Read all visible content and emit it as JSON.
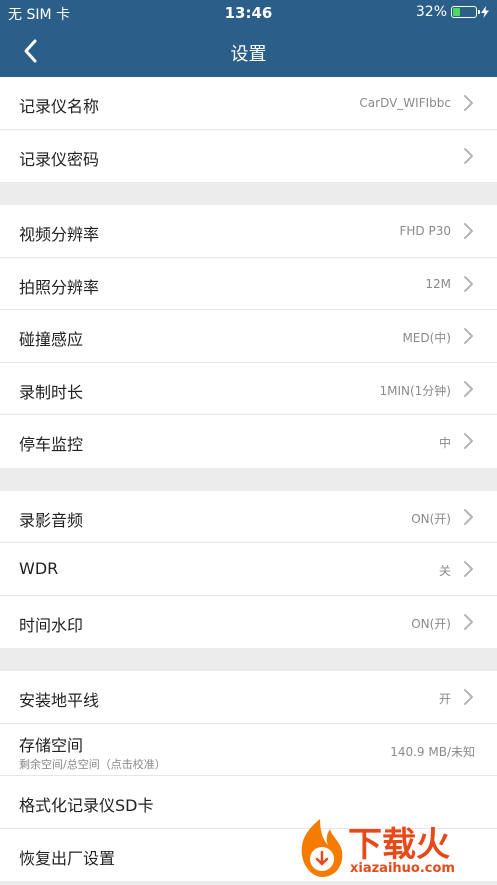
{
  "status": {
    "carrier": "无 SIM 卡",
    "time": "13:46",
    "battery": "32%",
    "battery_level": 0.32
  },
  "nav": {
    "title": "设置"
  },
  "groups": [
    [
      {
        "label": "记录仪名称",
        "value": "CarDV_WIFIbbc"
      },
      {
        "label": "记录仪密码",
        "value": ""
      }
    ],
    [
      {
        "label": "视频分辨率",
        "value": "FHD P30"
      },
      {
        "label": "拍照分辨率",
        "value": "12M"
      },
      {
        "label": "碰撞感应",
        "value": "MED(中)"
      },
      {
        "label": "录制时长",
        "value": "1MIN(1分钟)"
      },
      {
        "label": "停车监控",
        "value": "中"
      }
    ],
    [
      {
        "label": "录影音频",
        "value": "ON(开)"
      },
      {
        "label": "WDR",
        "value": "关"
      },
      {
        "label": "时间水印",
        "value": "ON(开)"
      }
    ],
    [
      {
        "label": "安装地平线",
        "value": "开"
      },
      {
        "label": "存储空间",
        "sub": "剩余空间/总空间（点击校准）",
        "value": "140.9 MB/未知"
      },
      {
        "label": "格式化记录仪SD卡",
        "value": ""
      },
      {
        "label": "恢复出厂设置",
        "value": ""
      }
    ]
  ],
  "watermark": {
    "brand": "下载火",
    "domain": "xiazaihuo.com"
  },
  "colors": {
    "header": "#2b5f8a",
    "battery": "#4cd964",
    "watermark": "#e64a19"
  }
}
